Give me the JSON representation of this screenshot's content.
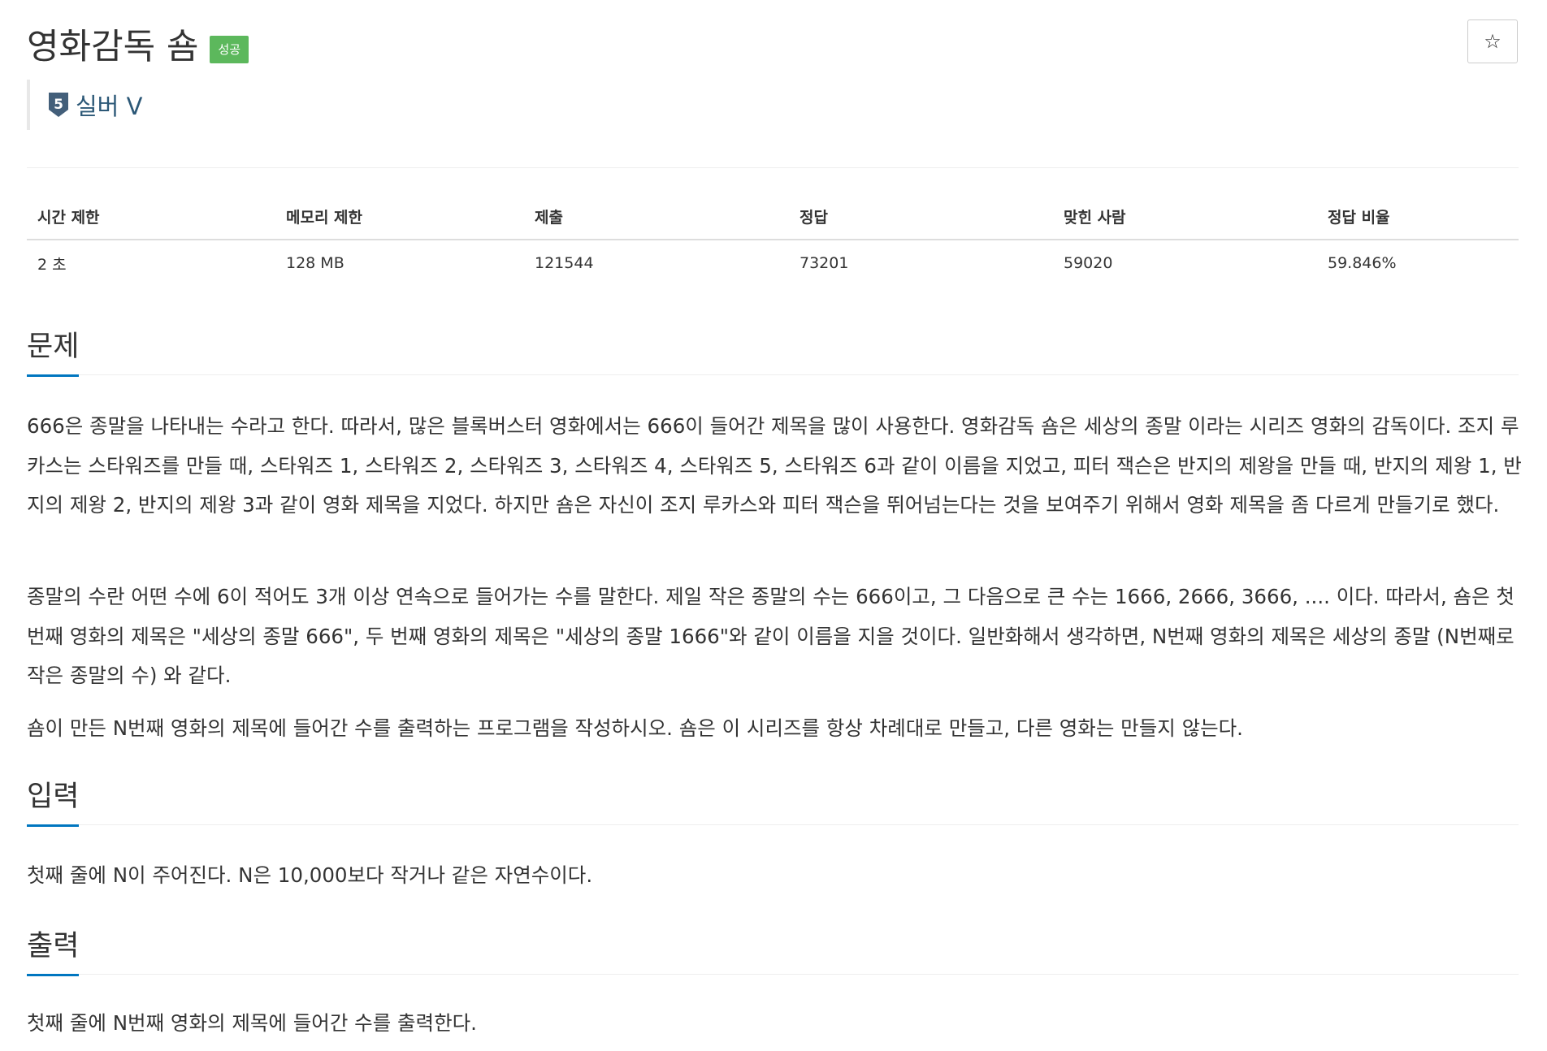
{
  "problem": {
    "title": "영화감독 숌",
    "status_badge": "성공",
    "star_icon": "☆",
    "tier": {
      "number": "5",
      "label": "실버 V",
      "color": "#435f7a"
    }
  },
  "info_table": {
    "headers": [
      "시간 제한",
      "메모리 제한",
      "제출",
      "정답",
      "맞힌 사람",
      "정답 비율"
    ],
    "values": [
      "2 초",
      "128 MB",
      "121544",
      "73201",
      "59020",
      "59.846%"
    ]
  },
  "sections": {
    "description": {
      "heading": "문제",
      "paragraphs": [
        "666은 종말을 나타내는 수라고 한다. 따라서, 많은 블록버스터 영화에서는 666이 들어간 제목을 많이 사용한다. 영화감독 숌은 세상의 종말 이라는 시리즈 영화의 감독이다. 조지 루카스는 스타워즈를 만들 때, 스타워즈 1, 스타워즈 2, 스타워즈 3, 스타워즈 4, 스타워즈 5, 스타워즈 6과 같이 이름을 지었고, 피터 잭슨은 반지의 제왕을 만들 때, 반지의 제왕 1, 반지의 제왕 2, 반지의 제왕 3과 같이 영화 제목을 지었다. 하지만 숌은 자신이 조지 루카스와 피터 잭슨을 뛰어넘는다는 것을 보여주기 위해서 영화 제목을 좀 다르게 만들기로 했다.",
        "종말의 수란 어떤 수에 6이 적어도 3개 이상 연속으로 들어가는 수를 말한다. 제일 작은 종말의 수는 666이고, 그 다음으로 큰 수는 1666, 2666, 3666, .... 이다. 따라서, 숌은 첫 번째 영화의 제목은 \"세상의 종말 666\", 두 번째 영화의 제목은 \"세상의 종말 1666\"와 같이 이름을 지을 것이다. 일반화해서 생각하면, N번째 영화의 제목은 세상의 종말 (N번째로 작은 종말의 수) 와 같다.",
        "숌이 만든 N번째 영화의 제목에 들어간 수를 출력하는 프로그램을 작성하시오. 숌은 이 시리즈를 항상 차례대로 만들고, 다른 영화는 만들지 않는다."
      ]
    },
    "input": {
      "heading": "입력",
      "paragraphs": [
        "첫째 줄에 N이 주어진다. N은 10,000보다 작거나 같은 자연수이다."
      ]
    },
    "output": {
      "heading": "출력",
      "paragraphs": [
        "첫째 줄에 N번째 영화의 제목에 들어간 수를 출력한다."
      ]
    }
  },
  "colors": {
    "badge_success": "#5cb85c",
    "tier_text": "#2c5877",
    "section_accent": "#0076c0"
  }
}
